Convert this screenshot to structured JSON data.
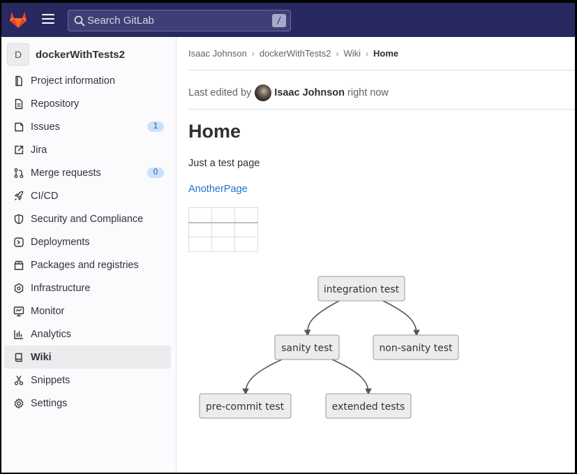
{
  "topbar": {
    "search_placeholder": "Search GitLab",
    "search_shortcut": "/",
    "logo_icon": "gitlab-tanuki-icon",
    "menu_icon": "hamburger-icon"
  },
  "sidebar": {
    "project_initial": "D",
    "project_name": "dockerWithTests2",
    "items": [
      {
        "label": "Project information",
        "icon": "project-icon",
        "badge": ""
      },
      {
        "label": "Repository",
        "icon": "document-icon",
        "badge": ""
      },
      {
        "label": "Issues",
        "icon": "issues-icon",
        "badge": "1"
      },
      {
        "label": "Jira",
        "icon": "external-link-icon",
        "badge": ""
      },
      {
        "label": "Merge requests",
        "icon": "merge-request-icon",
        "badge": "0"
      },
      {
        "label": "CI/CD",
        "icon": "rocket-icon",
        "badge": ""
      },
      {
        "label": "Security and Compliance",
        "icon": "shield-icon",
        "badge": ""
      },
      {
        "label": "Deployments",
        "icon": "deployments-icon",
        "badge": ""
      },
      {
        "label": "Packages and registries",
        "icon": "package-icon",
        "badge": ""
      },
      {
        "label": "Infrastructure",
        "icon": "infrastructure-icon",
        "badge": ""
      },
      {
        "label": "Monitor",
        "icon": "monitor-icon",
        "badge": ""
      },
      {
        "label": "Analytics",
        "icon": "chart-icon",
        "badge": ""
      },
      {
        "label": "Wiki",
        "icon": "book-icon",
        "badge": "",
        "active": true
      },
      {
        "label": "Snippets",
        "icon": "scissors-icon",
        "badge": ""
      },
      {
        "label": "Settings",
        "icon": "gear-icon",
        "badge": ""
      }
    ]
  },
  "breadcrumbs": [
    "Isaac Johnson",
    "dockerWithTests2",
    "Wiki",
    "Home"
  ],
  "meta": {
    "prefix": "Last edited by",
    "author": "Isaac Johnson",
    "time": "right now"
  },
  "page": {
    "title": "Home",
    "body": "Just a test page",
    "link": "AnotherPage"
  },
  "diagram": {
    "nodes": [
      "integration test",
      "sanity test",
      "non-sanity test",
      "pre-commit test",
      "extended tests"
    ]
  },
  "colors": {
    "topbar": "#292961",
    "link": "#1f75cb",
    "badge_bg": "#cbe2f9",
    "badge_text": "#0b5cad",
    "tanuki_orange": "#e24329"
  }
}
